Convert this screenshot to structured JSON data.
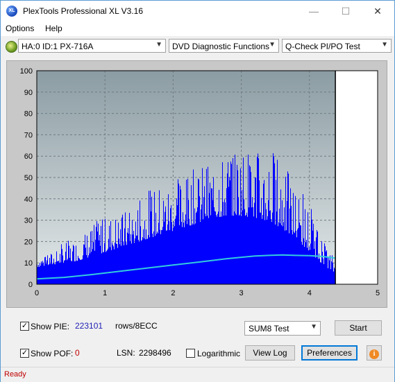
{
  "window": {
    "title": "PlexTools Professional XL V3.16",
    "minimize": "—",
    "maximize": "☐",
    "close": "✕",
    "accent": "#5a9bd5"
  },
  "menu": {
    "options": "Options",
    "help": "Help"
  },
  "toolbar": {
    "drive": "HA:0 ID:1  PX-716A",
    "function": "DVD Diagnostic Functions",
    "test": "Q-Check PI/PO Test"
  },
  "chart_data": {
    "type": "bar",
    "x_ticks": [
      "0",
      "1",
      "2",
      "3",
      "4",
      "5"
    ],
    "y_ticks": [
      "0",
      "10",
      "20",
      "30",
      "40",
      "50",
      "60",
      "70",
      "80",
      "90",
      "100"
    ],
    "xlim": [
      0,
      5
    ],
    "ylim": [
      0,
      100
    ],
    "grid": true,
    "data_end_x": 4.38,
    "colors": {
      "background": "#a3b0b5",
      "plot_bg_top": "#8fa0a6",
      "plot_bg_bottom": "#dce3e4",
      "bars": "#0000ff",
      "trend": "#33ccdd",
      "empty_region": "#ffffff"
    },
    "series": [
      {
        "type": "bar",
        "x": [
          0.0,
          0.2,
          0.4,
          0.6,
          0.8,
          1.0,
          1.2,
          1.4,
          1.6,
          1.8,
          2.0,
          2.2,
          2.4,
          2.6,
          2.8,
          3.0,
          3.2,
          3.4,
          3.6,
          3.8,
          4.0,
          4.2,
          4.38
        ],
        "base": [
          8,
          9,
          10,
          11,
          13,
          15,
          17,
          19,
          21,
          23,
          25,
          27,
          29,
          31,
          32,
          32,
          31,
          29,
          26,
          21,
          15,
          9,
          5
        ],
        "peak": [
          14,
          15,
          20,
          22,
          28,
          33,
          34,
          36,
          44,
          47,
          50,
          52,
          56,
          58,
          66,
          67,
          62,
          70,
          57,
          48,
          38,
          20,
          12
        ]
      },
      {
        "type": "line",
        "x": [
          0.0,
          0.4,
          0.8,
          1.2,
          1.6,
          2.0,
          2.4,
          2.8,
          3.2,
          3.4,
          3.6,
          3.8,
          4.0,
          4.2,
          4.38
        ],
        "values": [
          2.5,
          3.2,
          4.5,
          6.0,
          7.5,
          9.0,
          10.5,
          12.0,
          13.2,
          13.5,
          13.7,
          13.5,
          13.4,
          13.0,
          12.2
        ]
      }
    ]
  },
  "controls": {
    "show_pie_label": "Show PIE:",
    "pie_value": "223101",
    "rows_label": "rows/8ECC",
    "show_pof_label": "Show POF:",
    "pof_value": "0",
    "lsn_label": "LSN:",
    "lsn_value": "2298496",
    "logarithmic_label": "Logarithmic",
    "sum_test": "SUM8 Test",
    "start": "Start",
    "view_log": "View Log",
    "preferences": "Preferences",
    "checkmark": "✓",
    "info_symbol": "i",
    "pie_value_color": "#1f1fb4",
    "pof_value_color": "#c00000"
  },
  "status": {
    "text": "Ready"
  }
}
